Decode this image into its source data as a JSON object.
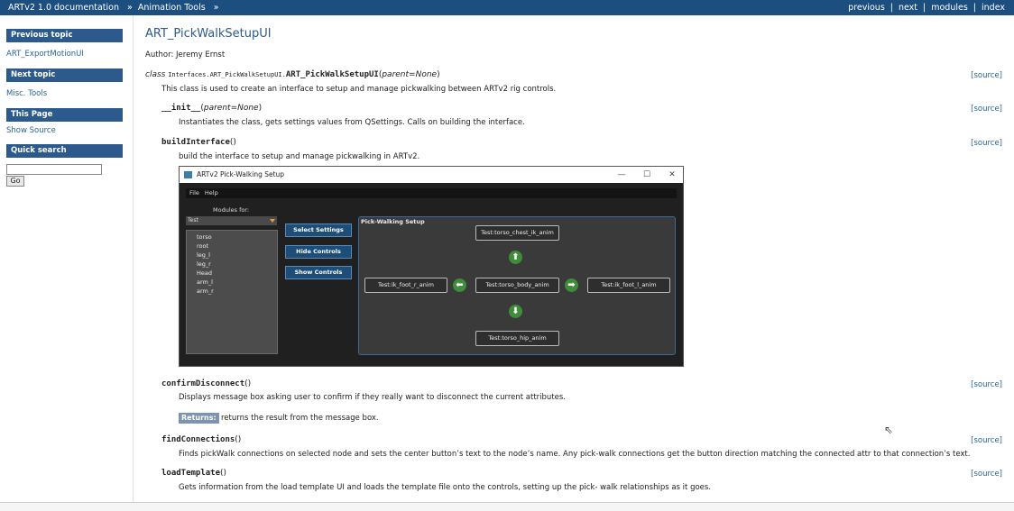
{
  "topbar": {
    "crumb1": "ARTv2 1.0 documentation",
    "crumb2": "Animation Tools",
    "arrow": "»",
    "links": {
      "previous": "previous",
      "next": "next",
      "modules": "modules",
      "index": "index"
    },
    "divider": "|"
  },
  "sidebar": {
    "prev_title": "Previous topic",
    "prev_link": "ART_ExportMotionUI",
    "next_title": "Next topic",
    "next_link": "Misc. Tools",
    "page_title": "This Page",
    "page_link": "Show Source",
    "search_title": "Quick search",
    "search_value": "",
    "go_label": "Go"
  },
  "main": {
    "title": "ART_PickWalkSetupUI",
    "author": "Author: Jeremy Ernst",
    "class_kw": "class",
    "class_prefix": "Interfaces.ART_PickWalkSetupUI.",
    "class_name": "ART_PickWalkSetupUI",
    "class_params": "parent=None",
    "class_desc": "This class is used to create an interface to setup and manage pickwalking between ARTv2 rig controls.",
    "source_label": "[source]",
    "init_name": "__init__",
    "init_params": "parent=None",
    "init_desc": "Instantiates the class, gets settings values from QSettings. Calls on building the interface.",
    "build_name": "buildInterface",
    "build_desc": "build the interface to setup and manage pickwalking in ARTv2.",
    "confirm_name": "confirmDisconnect",
    "confirm_desc": "Displays message box asking user to confirm if they really want to disconnect the current attributes.",
    "returns_label": "Returns:",
    "returns_text": "returns the result from the message box.",
    "find_name": "findConnections",
    "find_desc": "Finds pickWalk connections on selected node and sets the center button’s text to the node’s name. Any pick-walk connections get the button direction matching the connected attr to that connection’s text.",
    "load_name": "loadTemplate",
    "load_desc": "Gets information from the load template UI and loads the template file onto the controls, setting up the pick- walk relationships as it goes."
  },
  "screenshot": {
    "window_title": "ARTv2 Pick-Walking Setup",
    "win_buttons": [
      "—",
      "☐",
      "✕"
    ],
    "menu": [
      "File",
      "Help"
    ],
    "modules_label": "Modules for:",
    "modules_select": "Test",
    "modules": [
      "torso",
      "root",
      "leg_l",
      "leg_r",
      "Head",
      "arm_l",
      "arm_r"
    ],
    "select_settings": "Select Settings",
    "hide_controls": "Hide Controls",
    "show_controls": "Show Controls",
    "panel_title": "Pick-Walking Setup",
    "up": "Test:torso_chest_ik_anim",
    "left": "Test:ik_foot_r_anim",
    "center": "Test:torso_body_anim",
    "right": "Test:ik_foot_l_anim",
    "down": "Test:torso_hip_anim",
    "arrow_up": "⬆",
    "arrow_left": "⬅",
    "arrow_right": "➡",
    "arrow_down": "⬇"
  },
  "colors": {
    "topbar": "#1c4e80",
    "sidebar_head": "#2c5a8c",
    "link": "#2a6496",
    "returns": "#7e93ad"
  }
}
